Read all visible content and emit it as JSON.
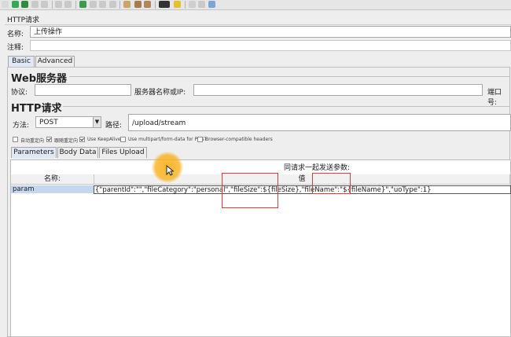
{
  "panel_title": "HTTP请求",
  "name_label": "名称:",
  "name_value": "上传操作",
  "comment_label": "注释:",
  "tabs": [
    "Basic",
    "Advanced"
  ],
  "web_server": {
    "title": "Web服务器",
    "protocol_label": "协议:",
    "server_label": "服务器名称或IP:",
    "port_label": "端口号:"
  },
  "http_request": {
    "title": "HTTP请求",
    "method_label": "方法:",
    "method_value": "POST",
    "path_label": "路径:",
    "path_value": "/upload/stream"
  },
  "options": [
    {
      "label": "自动重定向",
      "checked": false
    },
    {
      "label": "跟随重定向",
      "checked": true
    },
    {
      "label": "Use KeepAlive",
      "checked": true
    },
    {
      "label": "Use multipart/form-data for POST",
      "checked": false
    },
    {
      "label": "Browser-compatible headers",
      "checked": false
    }
  ],
  "subtabs": [
    "Parameters",
    "Body Data",
    "Files Upload"
  ],
  "params_caption": "同请求一起发送参数:",
  "columns": {
    "name": "名称:",
    "value": "值"
  },
  "rows": [
    {
      "name": "param",
      "value": "{\"parentId\":\"\",\"fileCategory\":\"personal\",\"fileSize\":${fileSize},\"fileName\":\"${fileName}\",\"uoType\":1}"
    }
  ],
  "colors": {
    "highlight_box": "#e23b3b",
    "cursor": "#f8b21e",
    "selected_cell": "#c5d8ef"
  }
}
